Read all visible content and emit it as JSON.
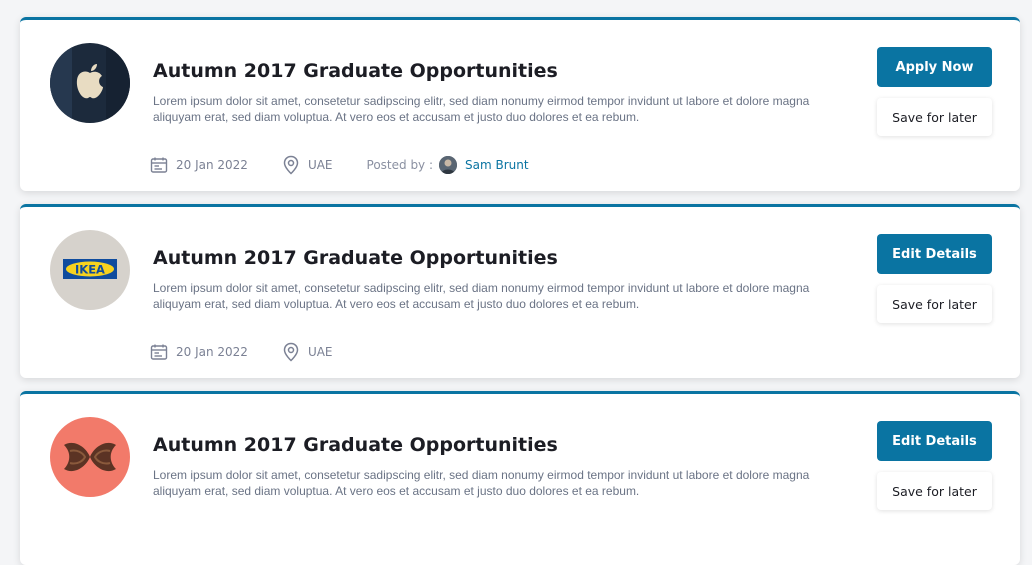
{
  "listings": [
    {
      "logo": "apple-logo",
      "title": "Autumn 2017 Graduate Opportunities",
      "description": "Lorem ipsum dolor sit amet, consetetur sadipscing elitr, sed diam nonumy eirmod tempor invidunt ut labore et dolore magna aliquyam erat, sed diam voluptua. At vero eos et accusam et justo duo dolores et ea rebum.",
      "date": "20 Jan 2022",
      "location": "UAE",
      "posted_by_label": "Posted by :",
      "posted_by_name": "Sam Brunt",
      "primary_action": "Apply Now",
      "secondary_action": "Save for later"
    },
    {
      "logo": "ikea-logo",
      "logo_text": "IKEA",
      "title": "Autumn 2017 Graduate Opportunities",
      "description": "Lorem ipsum dolor sit amet, consetetur sadipscing elitr, sed diam nonumy eirmod tempor invidunt ut labore et dolore magna aliquyam erat, sed diam voluptua. At vero eos et accusam et justo duo dolores et ea rebum.",
      "date": "20 Jan 2022",
      "location": "UAE",
      "primary_action": "Edit Details",
      "secondary_action": "Save for later"
    },
    {
      "logo": "pastry-logo",
      "title": "Autumn 2017 Graduate Opportunities",
      "description": "Lorem ipsum dolor sit amet, consetetur sadipscing elitr, sed diam nonumy eirmod tempor invidunt ut labore et dolore magna aliquyam erat, sed diam voluptua. At vero eos et accusam et justo duo dolores et ea rebum.",
      "primary_action": "Edit Details",
      "secondary_action": "Save for later"
    }
  ],
  "colors": {
    "accent": "#0a74a2",
    "title": "#1c1d24",
    "text": "#6a7385"
  }
}
